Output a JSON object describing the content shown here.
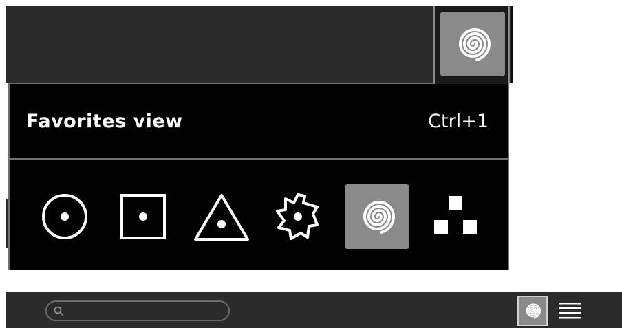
{
  "popover": {
    "title": "Favorites view",
    "shortcut": "Ctrl+1",
    "options": [
      {
        "icon": "circle-dot-icon",
        "selected": false
      },
      {
        "icon": "square-dot-icon",
        "selected": false
      },
      {
        "icon": "triangle-dot-icon",
        "selected": false
      },
      {
        "icon": "gear-dot-icon",
        "selected": false
      },
      {
        "icon": "spiral-icon",
        "selected": true
      },
      {
        "icon": "pyramid-squares-icon",
        "selected": false
      }
    ]
  },
  "topbar": {
    "active_view_icon": "spiral-icon"
  },
  "bottombar": {
    "search": {
      "value": "",
      "placeholder": "",
      "icon": "search-icon"
    },
    "view_button_icon": "spiral-icon",
    "menu_icon": "hamburger-menu-icon"
  },
  "colors": {
    "bar_background": "#2b2b2b",
    "popover_background": "#000000",
    "selected_tile": "#8a8a8a",
    "border": "#6f6f6f",
    "text": "#ffffff"
  }
}
